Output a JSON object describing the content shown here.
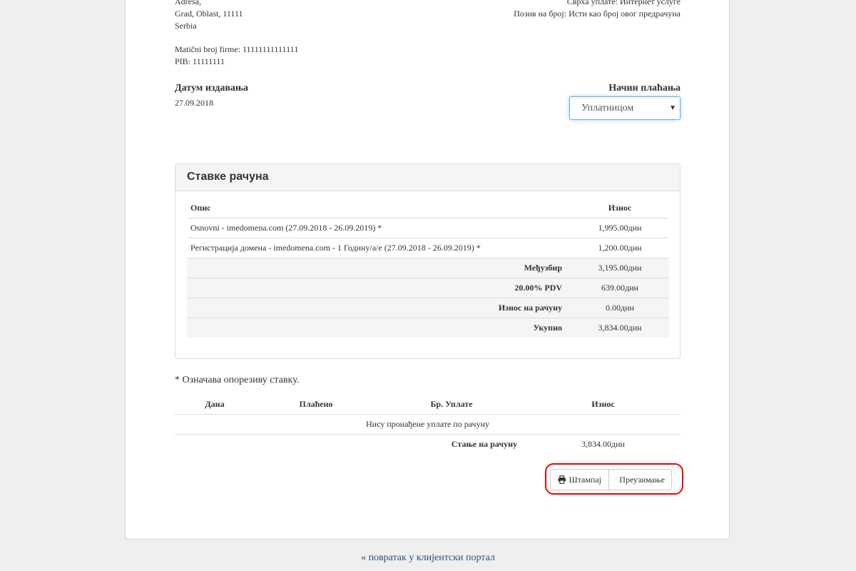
{
  "billing": {
    "address_lines": [
      "Adresa,",
      "Grad, Oblast, 11111",
      "Serbia"
    ],
    "company_id_label": "Matični broj firme:",
    "company_id_value": "11111111111111",
    "pib_label": "PIB:",
    "pib_value": "11111111"
  },
  "payment_info": {
    "purpose_line": "Сврха уплате: Интернет услуге",
    "reference_line": "Позив на број: Исти као број овог предрачуна"
  },
  "issue_date": {
    "label": "Датум издавања",
    "value": "27.09.2018"
  },
  "payment_method": {
    "label": "Начин плаћања",
    "selected": "Уплатницом"
  },
  "invoice_items": {
    "title": "Ставке рачуна",
    "headers": {
      "description": "Опис",
      "amount": "Износ"
    },
    "rows": [
      {
        "description": "Osnovni - imedomena.com (27.09.2018 - 26.09.2019) *",
        "amount": "1,995.00дин"
      },
      {
        "description": "Регистрација домена - imedomena.com - 1 Годину/а/е (27.09.2018 - 26.09.2019) *",
        "amount": "1,200.00дин"
      }
    ],
    "summary": [
      {
        "label": "Међузбир",
        "value": "3,195.00дин"
      },
      {
        "label": "20.00% PDV",
        "value": "639.00дин"
      },
      {
        "label": "Износ на рачуну",
        "value": "0.00дин"
      },
      {
        "label": "Укупно",
        "value": "3,834.00дин"
      }
    ]
  },
  "taxable_note": "* Означава опорезиву ставку.",
  "transactions": {
    "headers": {
      "date": "Дана",
      "gateway": "Плаћено",
      "trans_id": "Бр. Уплате",
      "amount": "Износ"
    },
    "empty_message": "Нису пронађене уплате по рачуну",
    "balance_label": "Стање на рачуну",
    "balance_value": "3,834.00дин"
  },
  "actions": {
    "print_label": "Штампај",
    "download_label": "Преузимање"
  },
  "back_link": "« повратак у клијентски портал",
  "colors": {
    "link": "#23527c",
    "highlight": "#e00000",
    "focus": "#66afe9"
  }
}
